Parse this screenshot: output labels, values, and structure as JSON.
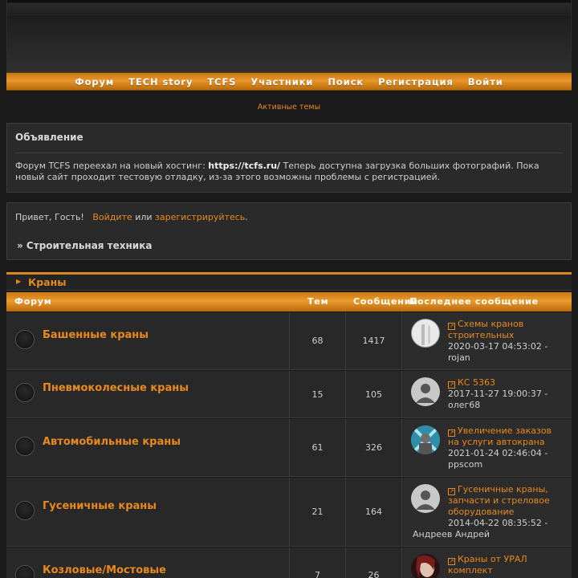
{
  "nav": {
    "items": [
      "Форум",
      "TECH story",
      "TCFS",
      "Участники",
      "Поиск",
      "Регистрация",
      "Войти"
    ]
  },
  "active_topics": "Активные темы",
  "announcement": {
    "title": "Объявление",
    "text_before": "Форум TCFS переехал на новый хостинг: ",
    "link": "https://tcfs.ru/",
    "text_after": " Теперь доступна загрузка больших фотографий. Пока новый сайт проходит тестовую отладку, из-за этого возможны проблемы с регистрацией."
  },
  "greeting": {
    "hello": "Привет, Гость!",
    "login": "Войдите",
    "or": "или",
    "register": "зарегистрируйтесь",
    "period": ".",
    "breadcrumb": "» Строительная техника"
  },
  "category": {
    "name": "Краны"
  },
  "table_header": {
    "forum": "Форум",
    "topics": "Тем",
    "posts": "Сообщений",
    "last_post": "Последнее сообщение"
  },
  "rows": [
    {
      "name": "Башенные краны",
      "topics": "68",
      "posts": "1417",
      "last_topic": "Схемы кранов строительных",
      "last_date": "2020-03-17 04:53:02 -",
      "last_author": "rojan"
    },
    {
      "name": "Пневмоколесные краны",
      "topics": "15",
      "posts": "105",
      "last_topic": "КС 5363",
      "last_date": "2017-11-27 19:00:37 -",
      "last_author": "олег68"
    },
    {
      "name": "Автомобильные краны",
      "topics": "61",
      "posts": "326",
      "last_topic": "Увеличение заказов на услуги автокрана",
      "last_date": "2021-01-24 02:46:04 -",
      "last_author": "ppscom"
    },
    {
      "name": "Гусеничные краны",
      "topics": "21",
      "posts": "164",
      "last_topic": "Гусеничные краны, запчасти и стреловое оборудование",
      "last_date": "2014-04-22 08:35:52 -",
      "last_author": "Андреев Андрей"
    },
    {
      "name": "Козловые/Мостовые",
      "topics": "7",
      "posts": "26",
      "last_topic": "Краны от УРАЛ комплект",
      "last_date": "",
      "last_author": ""
    }
  ],
  "colors": {
    "accent": "#e8891e",
    "background": "#1a1a1a",
    "panel": "#2a2a2a"
  }
}
